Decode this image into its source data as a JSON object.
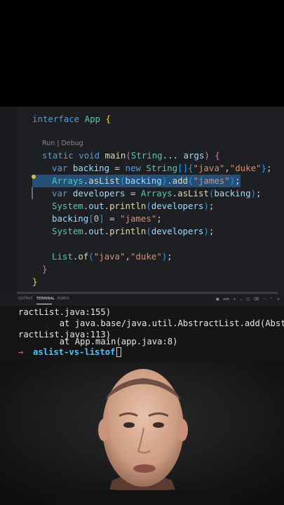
{
  "editor": {
    "codelens": "Run | Debug",
    "lines": {
      "l1": {
        "kw": "interface",
        "name": "App",
        "brace": "{"
      },
      "l2": {
        "kw1": "static",
        "kw2": "void",
        "fn": "main",
        "p1": "(",
        "type": "String",
        "dots": "...",
        "arg": "args",
        "p2": ")",
        "brace": "{"
      },
      "l3": {
        "kw": "var",
        "name": "backing",
        "eq": "=",
        "kw2": "new",
        "type": "String",
        "arr": "[]",
        "b1": "{",
        "s1": "\"java\"",
        "comma": ",",
        "s2": "\"duke\"",
        "b2": "}",
        "semi": ";"
      },
      "l4": {
        "cls": "Arrays",
        "dot1": ".",
        "fn1": "asList",
        "p1": "(",
        "arg": "backing",
        "p2": ")",
        "dot2": ".",
        "fn2": "add",
        "p3": "(",
        "str": "\"james\"",
        "p4": ")",
        "semi": ";"
      },
      "l5": {
        "kw": "var",
        "name": "developers",
        "eq": "=",
        "cls": "Arrays",
        "dot": ".",
        "fn": "asList",
        "p1": "(",
        "arg": "backing",
        "p2": ")",
        "semi": ";"
      },
      "l6": {
        "cls": "System",
        "dot1": ".",
        "field": "out",
        "dot2": ".",
        "fn": "println",
        "p1": "(",
        "arg": "developers",
        "p2": ")",
        "semi": ";"
      },
      "l7": {
        "name": "backing",
        "b1": "[",
        "idx": "0",
        "b2": "]",
        "eq": "=",
        "str": "\"james\"",
        "semi": ";"
      },
      "l8": {
        "cls": "System",
        "dot1": ".",
        "field": "out",
        "dot2": ".",
        "fn": "println",
        "p1": "(",
        "arg": "developers",
        "p2": ")",
        "semi": ";"
      },
      "l9": {
        "cls": "List",
        "dot": ".",
        "fn": "of",
        "p1": "(",
        "s1": "\"java\"",
        "comma": ",",
        "s2": "\"duke\"",
        "p2": ")",
        "semi": ";"
      },
      "l10": {
        "brace": "}"
      },
      "l11": {
        "brace": "}"
      }
    }
  },
  "panel": {
    "tabs": [
      "OUTPUT",
      "TERMINAL",
      "PORTS"
    ],
    "active_tab": "TERMINAL",
    "shell_label": "zsh",
    "terminal_lines": [
      "ractList.java:155)",
      "        at java.base/java.util.AbstractList.add(Abst",
      "ractList.java:113)",
      "        at App.main(app.java:8)"
    ],
    "prompt_symbol": "→",
    "prompt_dir": "aslist-vs-listof"
  },
  "colors": {
    "editor_bg": "#1e1f22",
    "selection": "#264f78",
    "keyword": "#569cd6",
    "type": "#4ec9b0",
    "string": "#ce9178",
    "prompt_dir": "#4fc3f7"
  }
}
